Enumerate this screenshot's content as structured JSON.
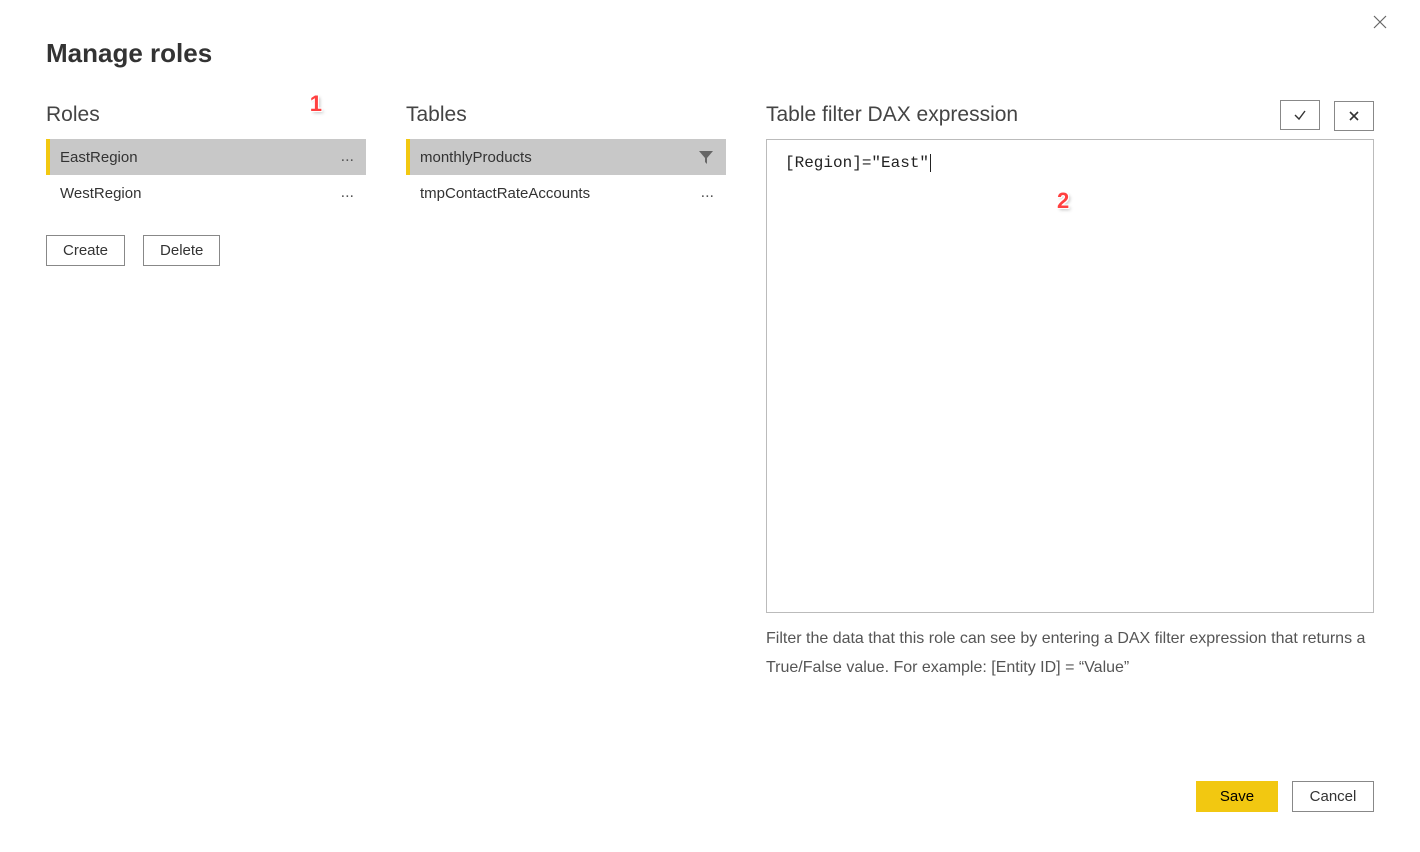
{
  "dialog": {
    "title": "Manage roles"
  },
  "roles": {
    "header": "Roles",
    "items": [
      {
        "name": "EastRegion",
        "selected": true
      },
      {
        "name": "WestRegion",
        "selected": false
      }
    ],
    "buttons": {
      "create": "Create",
      "delete": "Delete"
    }
  },
  "tables": {
    "header": "Tables",
    "items": [
      {
        "name": "monthlyProducts",
        "selected": true,
        "filtered": true
      },
      {
        "name": "tmpContactRateAccounts",
        "selected": false,
        "filtered": false
      }
    ]
  },
  "expression": {
    "header": "Table filter DAX expression",
    "value": "[Region]=\"East\"",
    "hint": "Filter the data that this role can see by entering a DAX filter expression that returns a True/False value. For example: [Entity ID] = “Value”",
    "accept_label": "✓",
    "reject_label": "✖"
  },
  "footer": {
    "save": "Save",
    "cancel": "Cancel"
  },
  "annotations": {
    "c1": "1",
    "c2": "2"
  }
}
